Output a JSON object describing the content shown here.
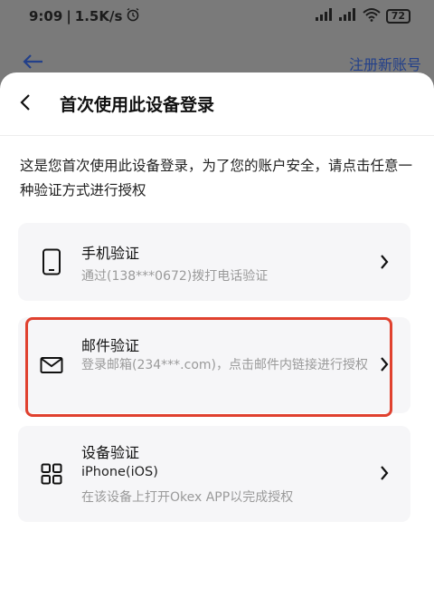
{
  "status_bar": {
    "time": "9:09",
    "speed": "1.5K/s",
    "battery": "72"
  },
  "background_header": {
    "register_link": "注册新账号"
  },
  "dialog": {
    "title": "首次使用此设备登录",
    "description": "这是您首次使用此设备登录，为了您的账户安全，请点击任意一种验证方式进行授权",
    "options": [
      {
        "title": "手机验证",
        "detail": "通过(138***0672)拨打电话验证",
        "icon": "phone-icon"
      },
      {
        "title": "邮件验证",
        "detail": "登录邮箱(234***.com)，点击邮件内链接进行授权",
        "icon": "mail-icon"
      },
      {
        "title": "设备验证",
        "device": "iPhone(iOS)",
        "detail": "在该设备上打开Okex APP以完成授权",
        "icon": "grid-icon"
      }
    ]
  },
  "colors": {
    "highlight": "#e0412f",
    "accent_link": "#23408a",
    "card_bg": "#f6f6f8"
  }
}
